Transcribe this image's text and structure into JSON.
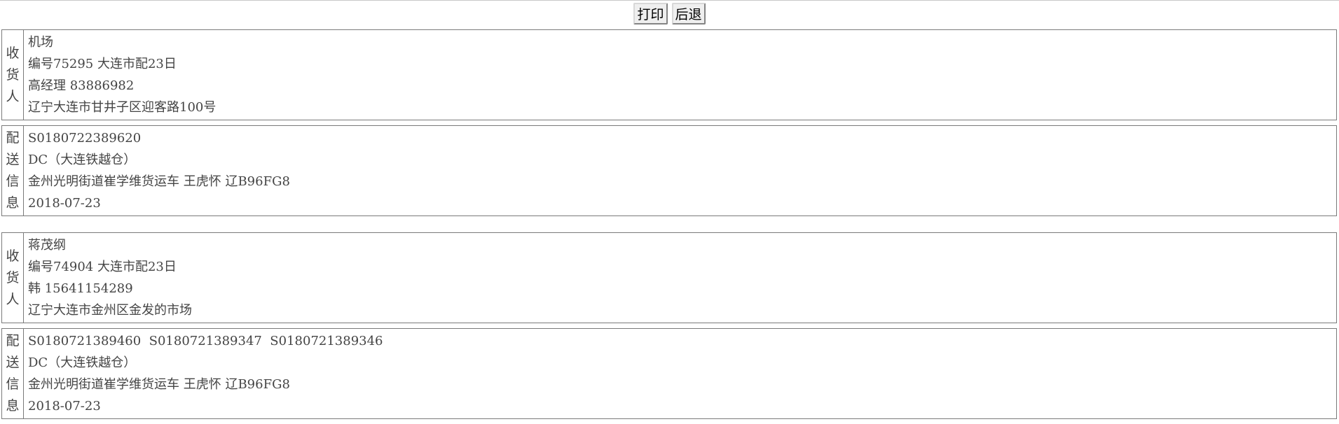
{
  "toolbar": {
    "print_label": "打印",
    "back_label": "后退"
  },
  "records": [
    {
      "receiver": {
        "side_label": [
          "收",
          "货",
          "人"
        ],
        "lines": [
          "机场",
          "编号75295 大连市配23日",
          "高经理 83886982",
          "辽宁大连市甘井子区迎客路100号"
        ]
      },
      "delivery": {
        "side_label": [
          "配",
          "送",
          "信",
          "息"
        ],
        "lines": [
          "S0180722389620",
          "DC（大连铁越仓）",
          "金州光明街道崔学维货运车 王虎怀 辽B96FG8",
          "2018-07-23"
        ]
      }
    },
    {
      "receiver": {
        "side_label": [
          "收",
          "货",
          "人"
        ],
        "lines": [
          "蒋茂纲",
          "编号74904 大连市配23日",
          "韩 15641154289",
          "辽宁大连市金州区金发的市场"
        ]
      },
      "delivery": {
        "side_label": [
          "配",
          "送",
          "信",
          "息"
        ],
        "lines": [
          "S0180721389460  S0180721389347  S0180721389346",
          "DC（大连铁越仓）",
          "金州光明街道崔学维货运车 王虎怀 辽B96FG8",
          "2018-07-23"
        ]
      }
    }
  ]
}
